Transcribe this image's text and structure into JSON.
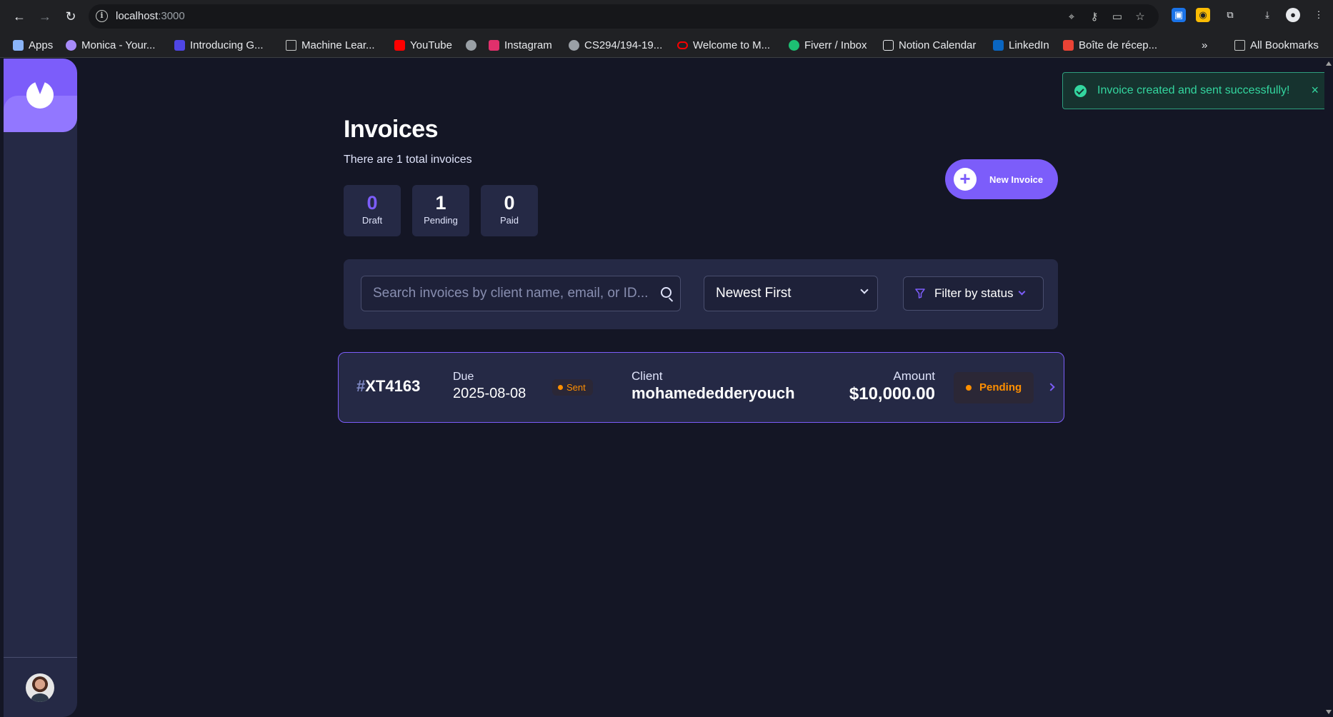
{
  "browser": {
    "url_host": "localhost",
    "url_port": ":3000",
    "bookmarks": [
      {
        "label": "Apps",
        "icon": "apps-grid-icon",
        "color": "#8ab4f8"
      },
      {
        "label": "Monica - Your...",
        "icon": "monica-icon",
        "color": "#a78bfa"
      },
      {
        "label": "Introducing G...",
        "icon": "gemini-icon",
        "color": "#4f46e5"
      },
      {
        "label": "Machine Lear...",
        "icon": "folder-icon",
        "color": "#c4c7c5"
      },
      {
        "label": "YouTube",
        "icon": "youtube-icon",
        "color": "#ff0000"
      },
      {
        "label": "",
        "icon": "globe-icon",
        "color": "#9aa0a6"
      },
      {
        "label": "Instagram",
        "icon": "instagram-icon",
        "color": "#e1306c"
      },
      {
        "label": "CS294/194-19...",
        "icon": "globe-icon",
        "color": "#9aa0a6"
      },
      {
        "label": "Welcome to M...",
        "icon": "oracle-icon",
        "color": "#f80000"
      },
      {
        "label": "Fiverr / Inbox",
        "icon": "fiverr-icon",
        "color": "#1dbf73"
      },
      {
        "label": "Notion Calendar",
        "icon": "notion-calendar-icon",
        "color": "#e8eaed"
      },
      {
        "label": "LinkedIn",
        "icon": "linkedin-icon",
        "color": "#0a66c2"
      },
      {
        "label": "Boîte de récep...",
        "icon": "gmail-icon",
        "color": "#ea4335"
      }
    ],
    "overflow_label": "»",
    "all_bookmarks_label": "All Bookmarks"
  },
  "page": {
    "title": "Invoices",
    "subtitle": "There are 1 total invoices"
  },
  "stats": [
    {
      "value": "0",
      "label": "Draft"
    },
    {
      "value": "1",
      "label": "Pending"
    },
    {
      "value": "0",
      "label": "Paid"
    }
  ],
  "new_invoice_label": "New Invoice",
  "search": {
    "placeholder": "Search invoices by client name, email, or ID..."
  },
  "sort": {
    "selected": "Newest First"
  },
  "filter": {
    "label": "Filter by status"
  },
  "invoices": [
    {
      "id_hash": "#",
      "id": "XT4163",
      "due_label": "Due",
      "due_date": "2025-08-08",
      "sent_status": "Sent",
      "client_label": "Client",
      "client": "mohamededderyouch",
      "amount_label": "Amount",
      "amount": "$10,000.00",
      "status": "Pending"
    }
  ],
  "toast": {
    "message": "Invoice created and sent successfully!",
    "close": "×"
  },
  "colors": {
    "accent": "#7c5dfa",
    "pending": "#ff8f00",
    "success": "#33d69f",
    "background": "#141625",
    "card": "#252945"
  }
}
